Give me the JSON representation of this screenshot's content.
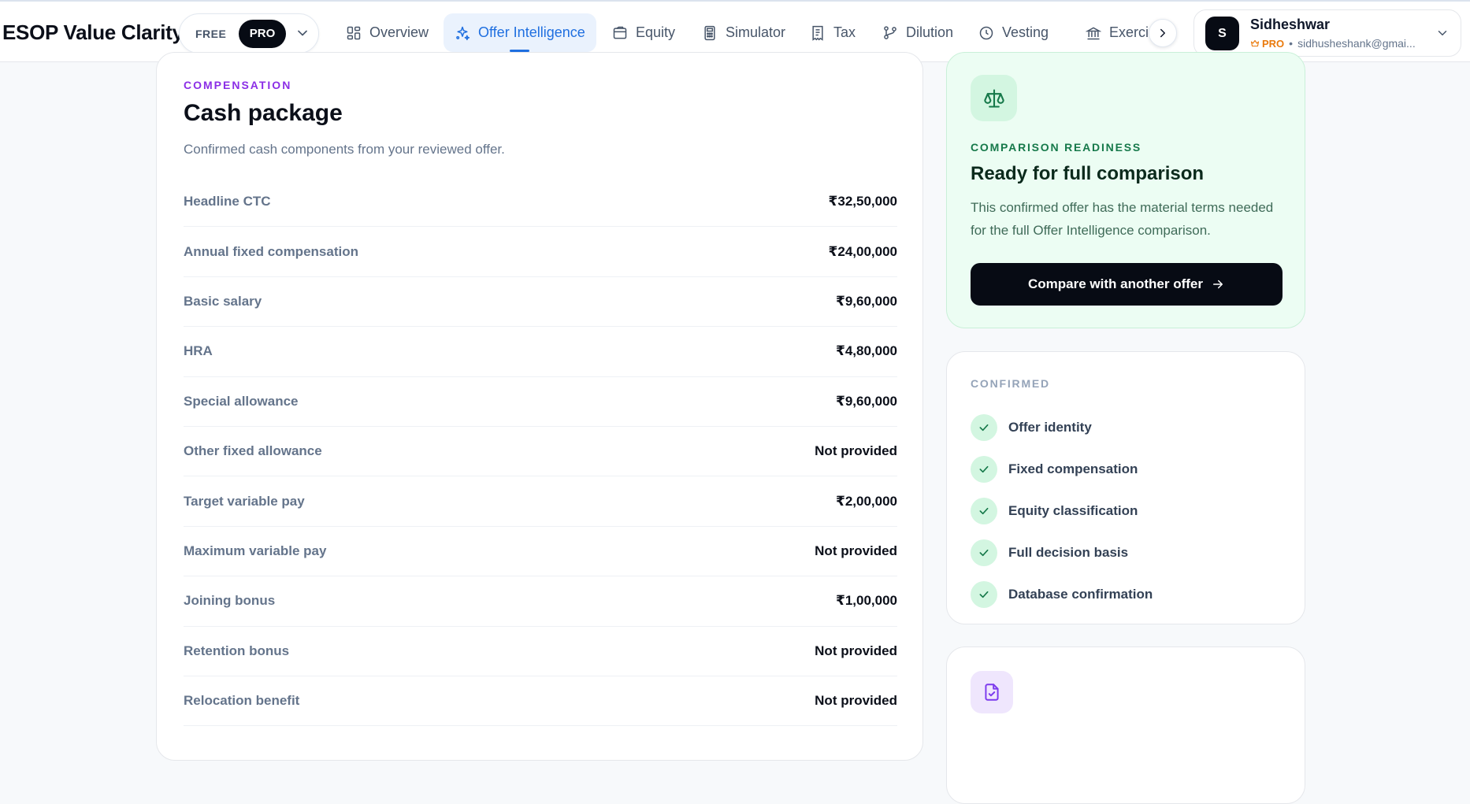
{
  "header": {
    "brand": "ESOP Value Clarity",
    "plan_switch": {
      "free_label": "FREE",
      "pro_label": "PRO"
    },
    "nav": [
      {
        "label": "Overview",
        "icon": "grid-icon"
      },
      {
        "label": "Offer Intelligence",
        "icon": "sparkle-icon",
        "active": true
      },
      {
        "label": "Equity",
        "icon": "wallet-icon"
      },
      {
        "label": "Simulator",
        "icon": "calculator-icon"
      },
      {
        "label": "Tax",
        "icon": "receipt-icon"
      },
      {
        "label": "Dilution",
        "icon": "branch-icon"
      },
      {
        "label": "Vesting",
        "icon": "clock-icon"
      },
      {
        "label": "Exercise",
        "icon": "bank-icon"
      }
    ],
    "user": {
      "initial": "S",
      "name": "Sidheshwar",
      "plan": "PRO",
      "email": "sidhusheshank@gmai..."
    }
  },
  "cash": {
    "eyebrow": "COMPENSATION",
    "title": "Cash package",
    "subtitle": "Confirmed cash components from your reviewed offer.",
    "rows": [
      {
        "label": "Headline CTC",
        "value": "₹32,50,000"
      },
      {
        "label": "Annual fixed compensation",
        "value": "₹24,00,000"
      },
      {
        "label": "Basic salary",
        "value": "₹9,60,000"
      },
      {
        "label": "HRA",
        "value": "₹4,80,000"
      },
      {
        "label": "Special allowance",
        "value": "₹9,60,000"
      },
      {
        "label": "Other fixed allowance",
        "value": "Not provided"
      },
      {
        "label": "Target variable pay",
        "value": "₹2,00,000"
      },
      {
        "label": "Maximum variable pay",
        "value": "Not provided"
      },
      {
        "label": "Joining bonus",
        "value": "₹1,00,000"
      },
      {
        "label": "Retention bonus",
        "value": "Not provided"
      },
      {
        "label": "Relocation benefit",
        "value": "Not provided"
      }
    ]
  },
  "readiness": {
    "eyebrow": "COMPARISON READINESS",
    "title": "Ready for full comparison",
    "description": "This confirmed offer has the material terms needed for the full Offer Intelligence comparison.",
    "button_label": "Compare with another offer"
  },
  "confirmed": {
    "eyebrow": "CONFIRMED",
    "items": [
      "Offer identity",
      "Fixed compensation",
      "Equity classification",
      "Full decision basis",
      "Database confirmation"
    ]
  },
  "colors": {
    "accent_blue": "#1f6fe0",
    "eyebrow_purple": "#8b2ee6",
    "success_green": "#16794a",
    "pro_orange": "#ea7a0c"
  }
}
